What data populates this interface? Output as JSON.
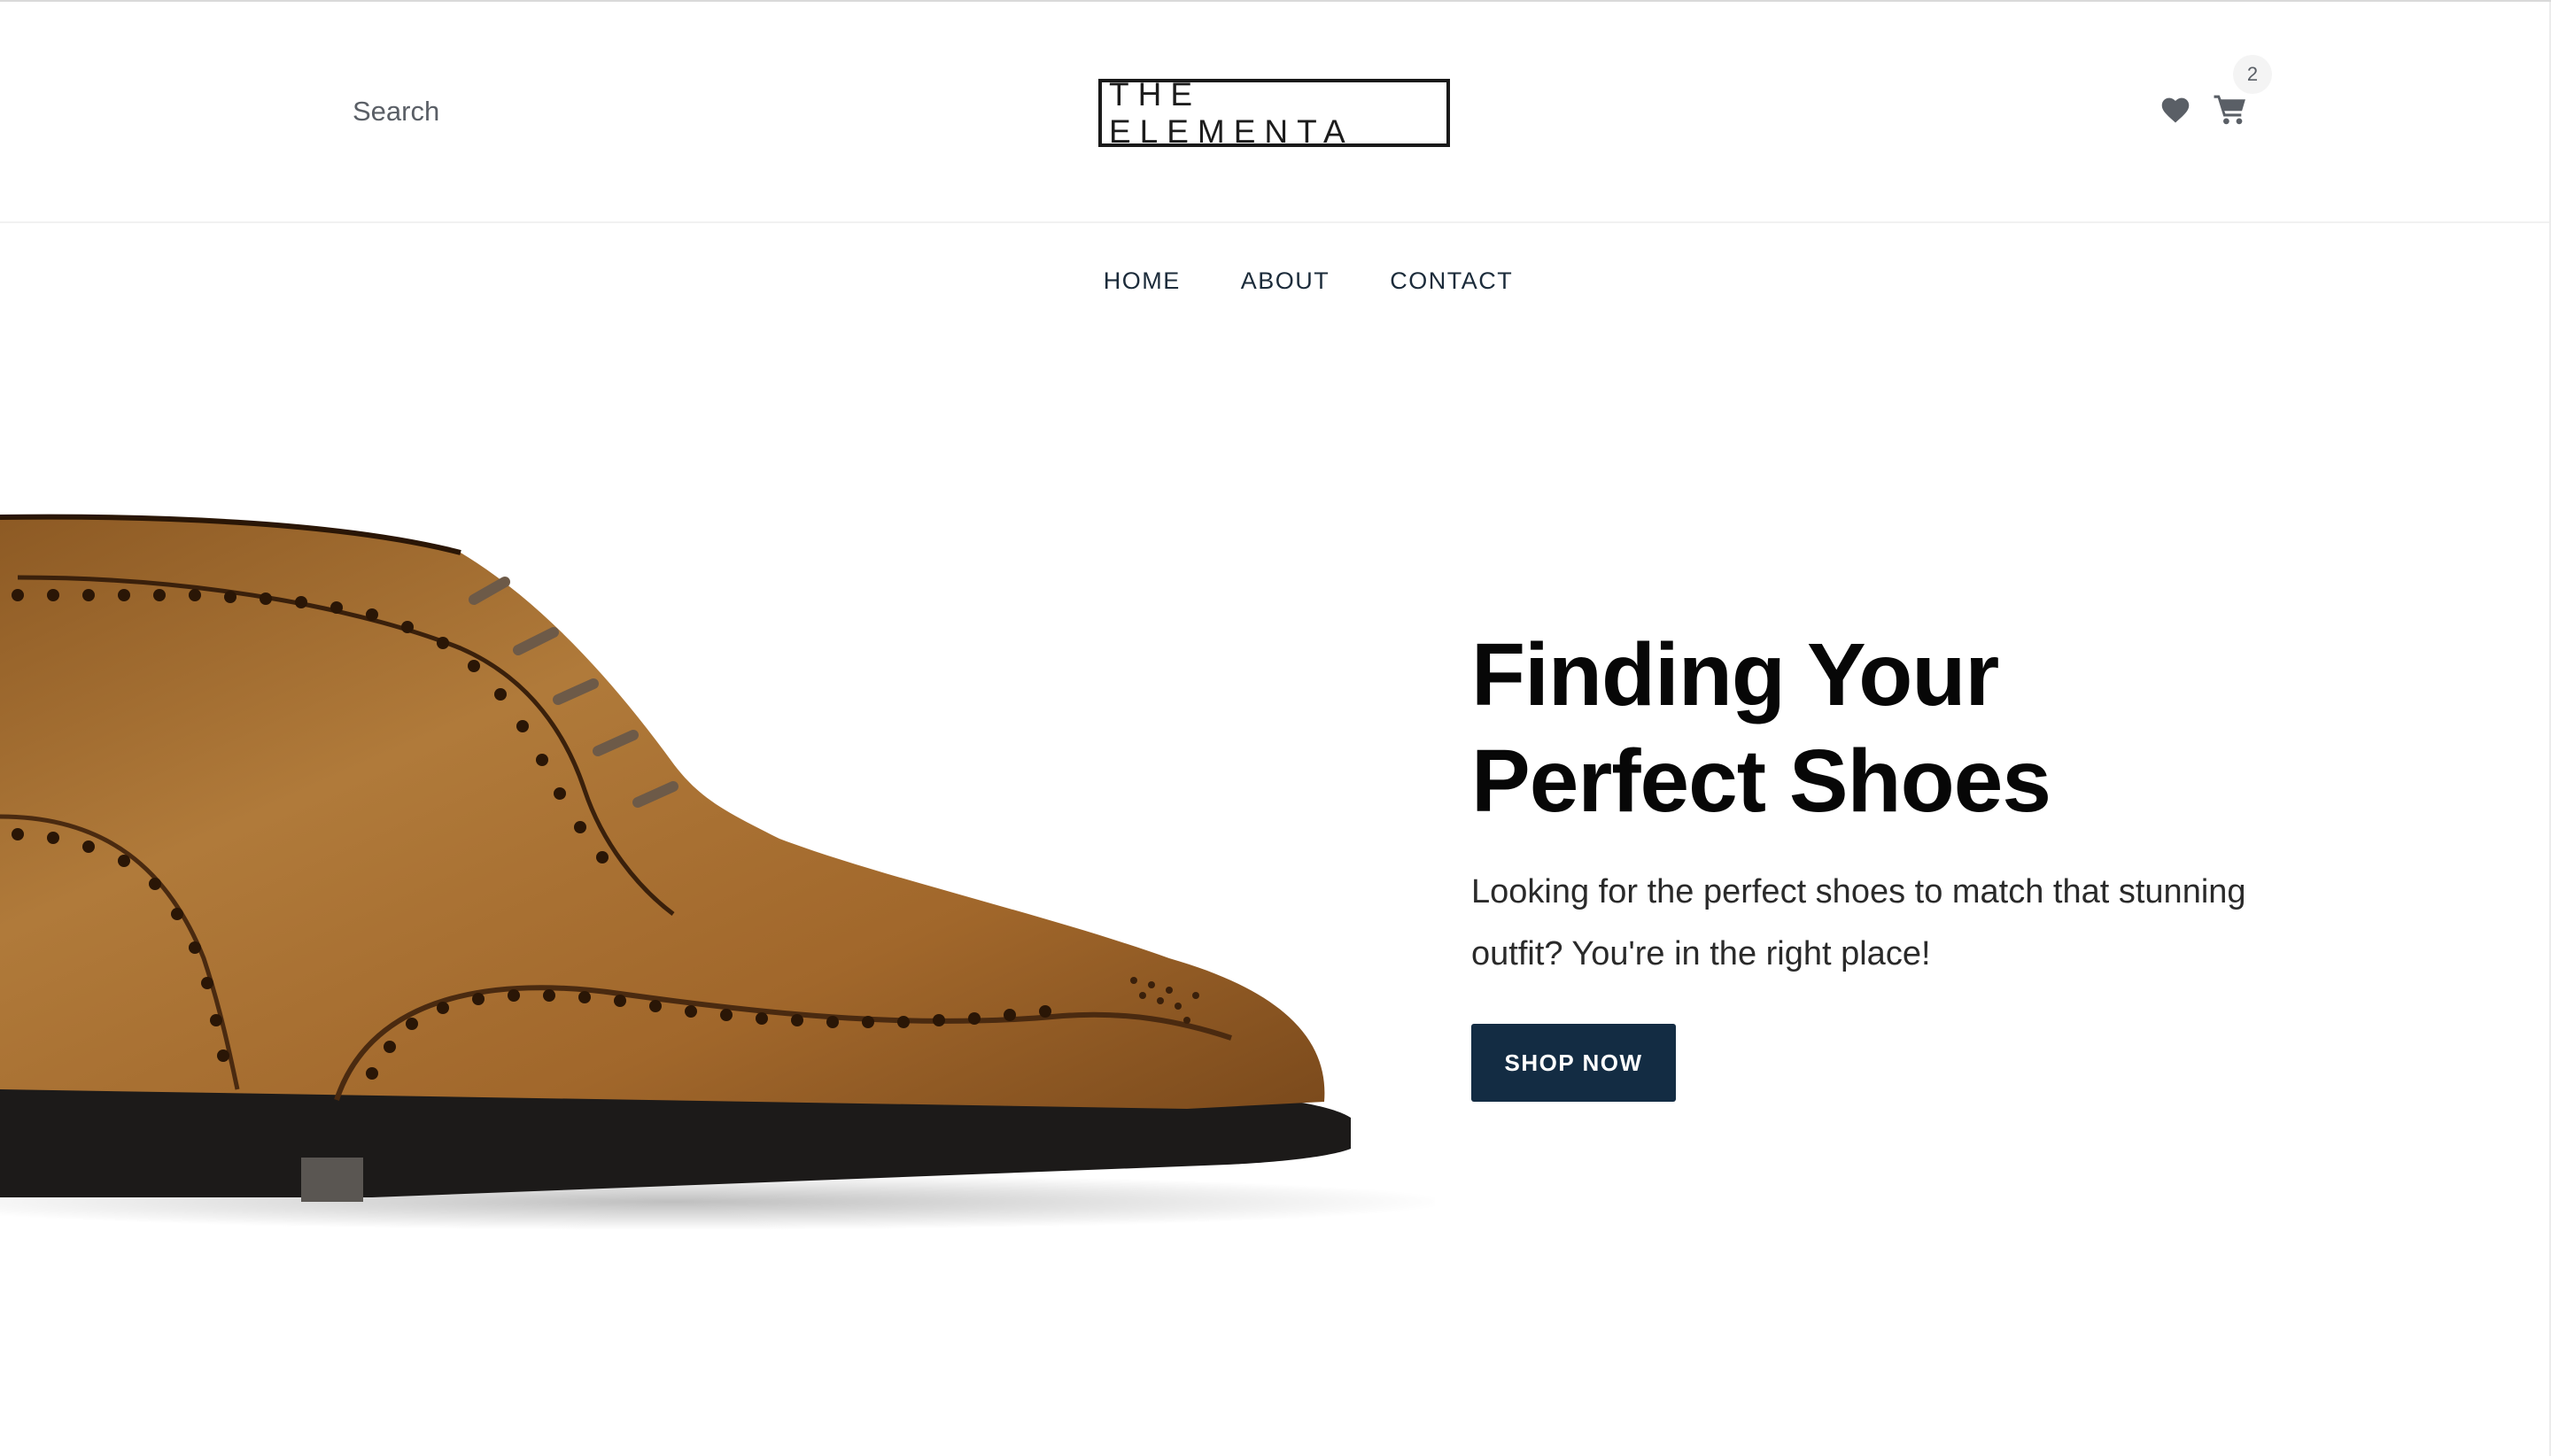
{
  "header": {
    "search_label": "Search",
    "logo_text": "THE ELEMENTA",
    "cart_count": "2",
    "icons": [
      "heart-icon",
      "cart-icon"
    ]
  },
  "nav": {
    "items": [
      {
        "label": "HOME"
      },
      {
        "label": "ABOUT"
      },
      {
        "label": "CONTACT"
      }
    ]
  },
  "hero": {
    "title_line1": "Finding Your",
    "title_line2": "Perfect Shoes",
    "description": "Looking for the perfect shoes to match that stunning outfit? You're in the right place!",
    "button_label": "SHOP NOW"
  },
  "colors": {
    "accent": "#132c43",
    "text_dark": "#070707",
    "icon_gray": "#5a5f66",
    "leather": "#a86a2c"
  }
}
